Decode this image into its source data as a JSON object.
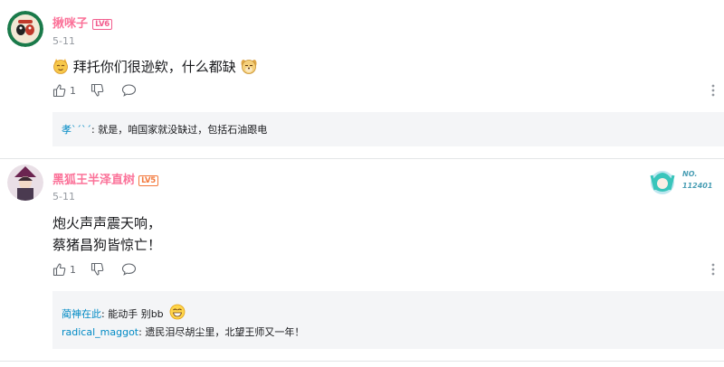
{
  "comments": [
    {
      "username": "揪咪子",
      "level": "LV6",
      "date": "5-11",
      "text_before": "拜托你们很逊欸，什么都缺",
      "emoji_icons": [
        "cat-smug-emoji-icon",
        "dog-smug-emoji-icon"
      ],
      "like_count": "1",
      "replies": [
        {
          "name": "孝ˋˊˋˊ",
          "text": ": 就是，咱国家就没缺过，包括石油跟电"
        }
      ]
    },
    {
      "username": "黑狐王半泽直树",
      "level": "LV5",
      "date": "5-11",
      "text_lines": [
        "炮火声声震天响，",
        "蔡猪昌狗皆惊亡！"
      ],
      "like_count": "1",
      "badge_text": [
        "NO.",
        "112401"
      ],
      "replies": [
        {
          "name": "蔺神在此",
          "text": ": 能动手 别bb"
        },
        {
          "name": "radical_maggot",
          "text": ": 遗民泪尽胡尘里，北望王师又一年！"
        }
      ]
    }
  ],
  "colors": {
    "username": "#fb7299",
    "reply_name": "#008ac5",
    "reply_bg": "#f4f5f7",
    "meta": "#9499a0"
  },
  "icons": [
    "like-icon",
    "dislike-icon",
    "reply-icon",
    "more-vertical-icon"
  ]
}
